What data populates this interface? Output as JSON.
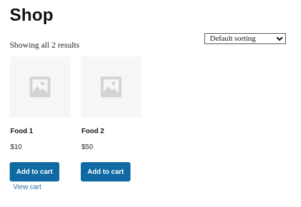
{
  "page": {
    "title": "Shop"
  },
  "results": {
    "count_text": "Showing all 2 results"
  },
  "sorting": {
    "selected": "Default sorting",
    "options": [
      "Default sorting"
    ]
  },
  "products": [
    {
      "name": "Food 1",
      "price": "$10",
      "button_label": "Add to cart",
      "view_cart_label": "View cart",
      "image": "placeholder-image-icon"
    },
    {
      "name": "Food 2",
      "price": "$50",
      "button_label": "Add to cart",
      "image": "placeholder-image-icon"
    }
  ],
  "colors": {
    "button_bg": "#0f6aa3",
    "link": "#2a6fa8",
    "thumb_bg": "#f6f6f6",
    "placeholder_icon": "#d0d0d0"
  }
}
